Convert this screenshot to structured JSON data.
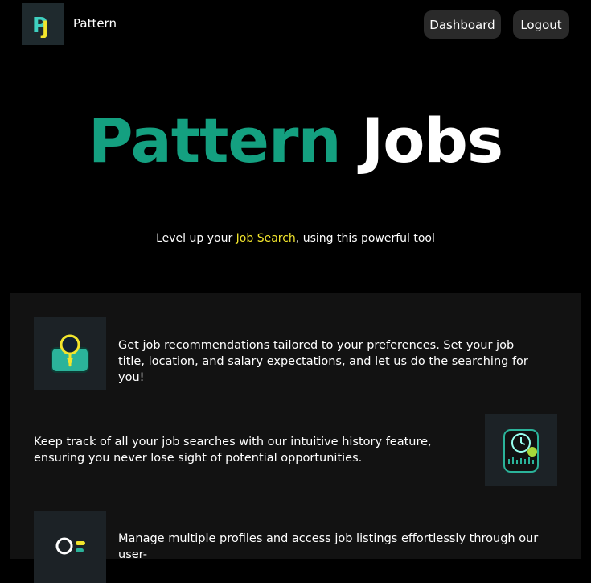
{
  "nav": {
    "logo_text": "PJ",
    "brand": "Pattern",
    "dashboard_label": "Dashboard",
    "logout_label": "Logout"
  },
  "hero": {
    "title_part1": "Pattern",
    "title_part2": "Jobs"
  },
  "tagline": {
    "prefix": "Level up your ",
    "highlight": "Job Search",
    "suffix": ", using this powerful tool"
  },
  "features": [
    {
      "icon": "briefcase-search-icon",
      "text": "Get job recommendations tailored to your preferences. Set your job title, location, and salary expectations, and let us do the searching for you!"
    },
    {
      "icon": "history-clock-icon",
      "text": "Keep track of all your job searches with our intuitive history feature, ensuring you never lose sight of potential opportunities."
    },
    {
      "icon": "profiles-toggle-icon",
      "text": "Manage multiple profiles and access job listings effortlessly through our user-"
    }
  ],
  "colors": {
    "accent": "#14a080",
    "highlight": "#f2e52c",
    "panel": "#121212"
  }
}
